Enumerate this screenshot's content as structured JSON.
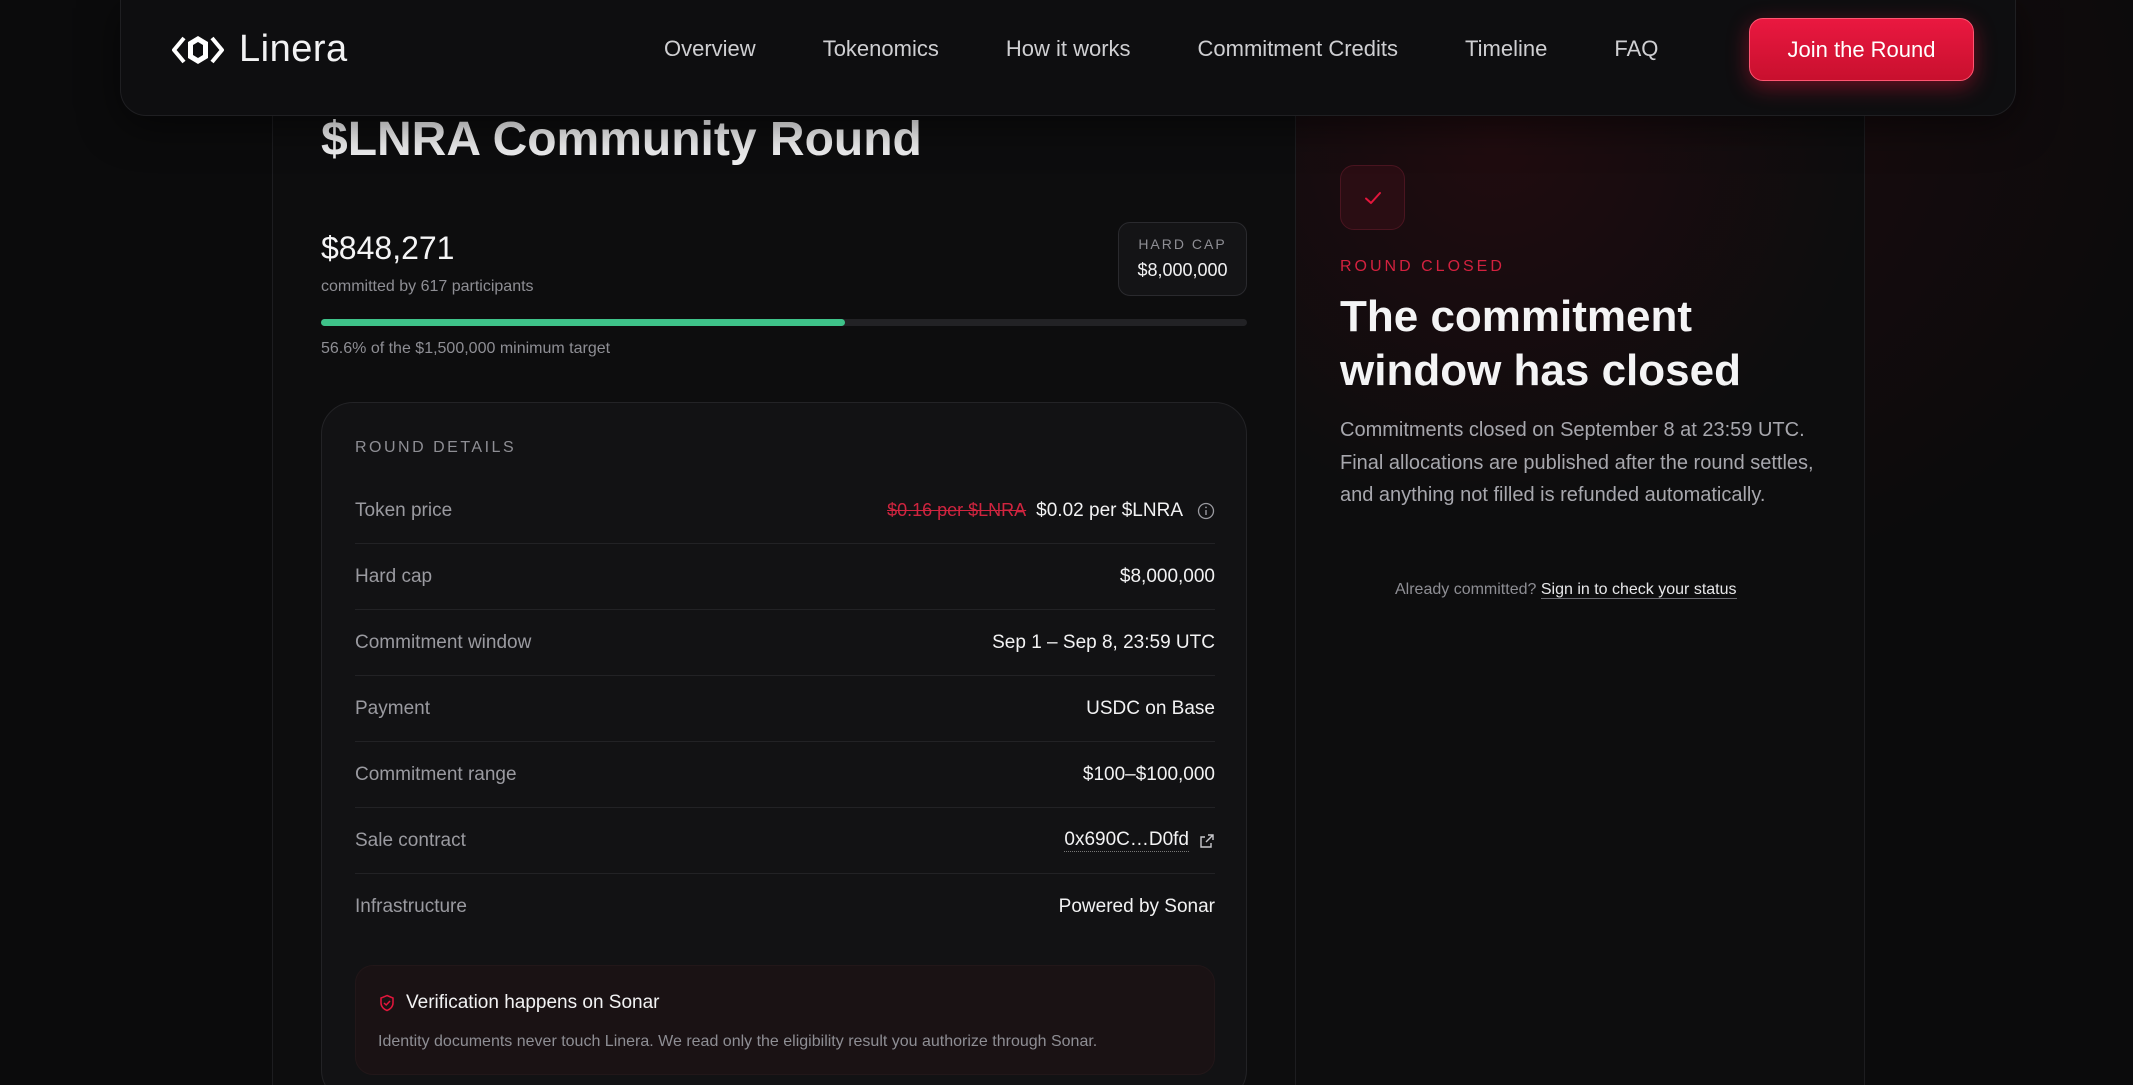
{
  "nav": {
    "logo_text": "Linera",
    "links": [
      "Overview",
      "Tokenomics",
      "How it works",
      "Commitment Credits",
      "Timeline",
      "FAQ"
    ],
    "cta": "Join the Round"
  },
  "round": {
    "title": "$LNRA Community Round",
    "amount": "$848,271",
    "committed_by": "committed by 617 participants",
    "hard_cap_label": "HARD CAP",
    "hard_cap_value": "$8,000,000",
    "progress_fraction": 0.566,
    "progress_caption": "56.6% of the $1,500,000 minimum target"
  },
  "details": {
    "title": "ROUND DETAILS",
    "rows": [
      {
        "label": "Token price",
        "old_value": "$0.16 per $LNRA",
        "value": "$0.02 per $LNRA"
      },
      {
        "label": "Hard cap",
        "value": "$8,000,000"
      },
      {
        "label": "Commitment window",
        "value": "Sep 1 – Sep 8, 23:59 UTC"
      },
      {
        "label": "Payment",
        "value": "USDC on Base"
      },
      {
        "label": "Commitment range",
        "value": "$100–$100,000"
      },
      {
        "label": "Sale contract",
        "value": "0x690C…D0fd"
      },
      {
        "label": "Infrastructure",
        "value": "Powered by Sonar"
      }
    ],
    "verify_title": "Verification happens on Sonar",
    "verify_text": "Identity documents never touch Linera. We read only the eligibility result you authorize through Sonar."
  },
  "status": {
    "label": "ROUND CLOSED",
    "title": "The commitment window has closed",
    "text": "Commitments closed on September 8 at 23:59 UTC. Final allocations are published after the round settles, and anything not filled is refunded automatically.",
    "already_prefix": "Already committed?",
    "signin_link": "Sign in to check your status"
  },
  "colors": {
    "accent": "#e3163c",
    "progress": "#3ec289",
    "background": "#0b0b0c"
  }
}
